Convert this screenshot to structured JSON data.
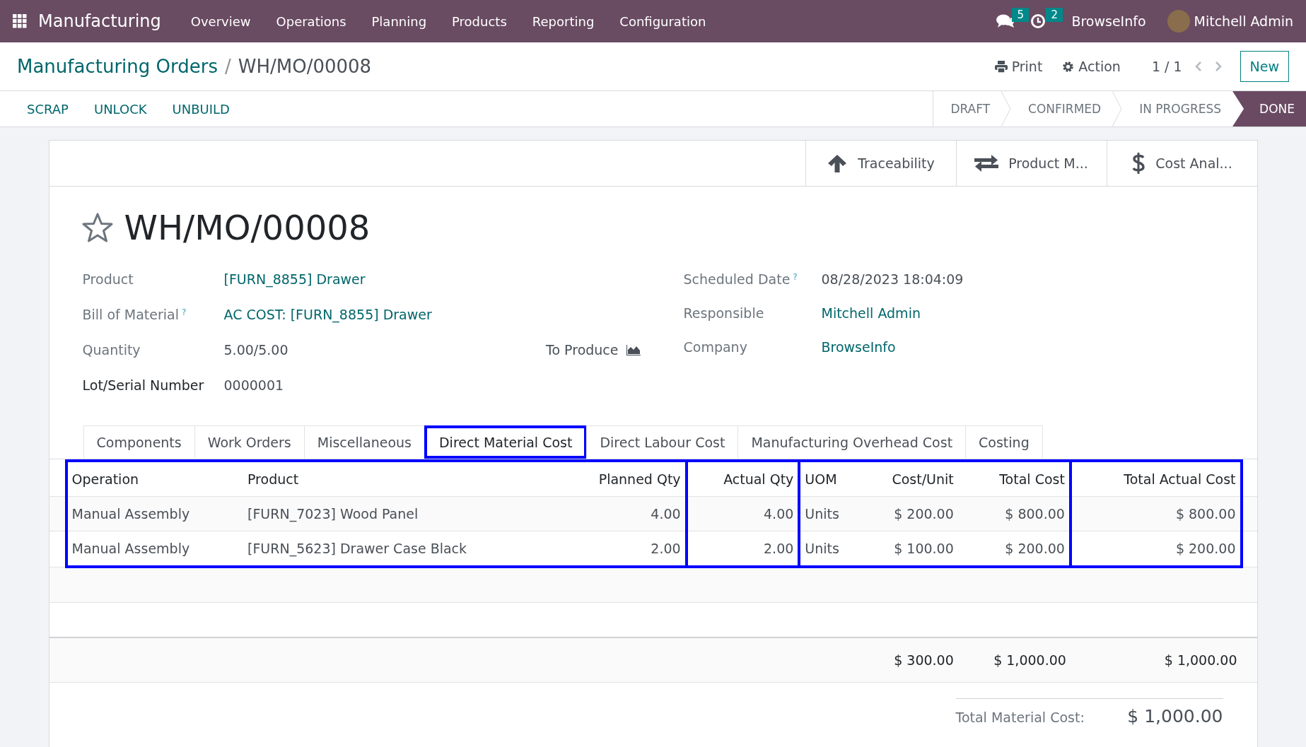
{
  "navbar": {
    "app_name": "Manufacturing",
    "menu": [
      "Overview",
      "Operations",
      "Planning",
      "Products",
      "Reporting",
      "Configuration"
    ],
    "messages_count": "5",
    "activities_count": "2",
    "company": "BrowseInfo",
    "user": "Mitchell Admin"
  },
  "control_panel": {
    "breadcrumb": "Manufacturing Orders",
    "separator": "/",
    "current": "WH/MO/00008",
    "print": "Print",
    "action": "Action",
    "pager": "1 / 1",
    "new_button": "New"
  },
  "actions": [
    "SCRAP",
    "UNLOCK",
    "UNBUILD"
  ],
  "stages": [
    {
      "label": "DRAFT",
      "selected": false
    },
    {
      "label": "CONFIRMED",
      "selected": false
    },
    {
      "label": "IN PROGRESS",
      "selected": false
    },
    {
      "label": "DONE",
      "selected": true
    }
  ],
  "smart_buttons": [
    {
      "kind": "arrow-up",
      "label": "Traceability"
    },
    {
      "kind": "swap",
      "label": "Product M..."
    },
    {
      "kind": "dollar",
      "label": "Cost Anal..."
    }
  ],
  "title": {
    "favorite": false,
    "name": "WH/MO/00008"
  },
  "left_fields": [
    {
      "label": "Product",
      "value": "[FURN_8855] Drawer",
      "link": true,
      "strong": false
    },
    {
      "label": "Bill of Material",
      "help": "?",
      "value": "AC COST: [FURN_8855] Drawer",
      "link": true,
      "strong": false
    },
    {
      "label": "Quantity",
      "value": "5.00/5.00",
      "link": false,
      "strong": false,
      "extra": "To Produce"
    },
    {
      "label": "Lot/Serial Number",
      "value": "0000001",
      "link": false,
      "strong": true
    }
  ],
  "right_fields": [
    {
      "label": "Scheduled Date",
      "help": "?",
      "value": "08/28/2023 18:04:09",
      "link": false
    },
    {
      "label": "Responsible",
      "value": "Mitchell Admin",
      "link": true
    },
    {
      "label": "Company",
      "value": "BrowseInfo",
      "link": true
    }
  ],
  "tabs": [
    {
      "label": "Components",
      "selected": false,
      "highlighted": false
    },
    {
      "label": "Work Orders",
      "selected": false,
      "highlighted": false
    },
    {
      "label": "Miscellaneous",
      "selected": false,
      "highlighted": false
    },
    {
      "label": "Direct Material Cost",
      "selected": true,
      "highlighted": true
    },
    {
      "label": "Direct Labour Cost",
      "selected": false,
      "highlighted": false
    },
    {
      "label": "Manufacturing Overhead Cost",
      "selected": false,
      "highlighted": false
    },
    {
      "label": "Costing",
      "selected": false,
      "highlighted": false
    }
  ],
  "table": {
    "columns": [
      {
        "label": "Operation",
        "kind": "text",
        "highlight_start": true
      },
      {
        "label": "Product",
        "kind": "text",
        "highlight_start": false
      },
      {
        "label": "Planned Qty",
        "kind": "number",
        "highlight_start": false
      },
      {
        "label": "Actual Qty",
        "kind": "number",
        "highlight_start": true
      },
      {
        "label": "UOM",
        "kind": "text",
        "highlight_start": true
      },
      {
        "label": "Cost/Unit",
        "kind": "number",
        "highlight_start": false,
        "total": "$ 300.00"
      },
      {
        "label": "Total Cost",
        "kind": "number",
        "highlight_start": false,
        "total": "$ 1,000.00"
      },
      {
        "label": "Total Actual Cost",
        "kind": "number",
        "highlight_start": true,
        "total": "$ 1,000.00"
      }
    ],
    "rows": [
      [
        "Manual Assembly",
        "[FURN_7023] Wood Panel",
        "4.00",
        "4.00",
        "Units",
        "$ 200.00",
        "$ 800.00",
        "$ 800.00"
      ],
      [
        "Manual Assembly",
        "[FURN_5623] Drawer Case Black",
        "2.00",
        "2.00",
        "Units",
        "$ 100.00",
        "$ 200.00",
        "$ 200.00"
      ]
    ]
  },
  "summary": {
    "label": "Total Material Cost:",
    "value": "$ 1,000.00"
  }
}
